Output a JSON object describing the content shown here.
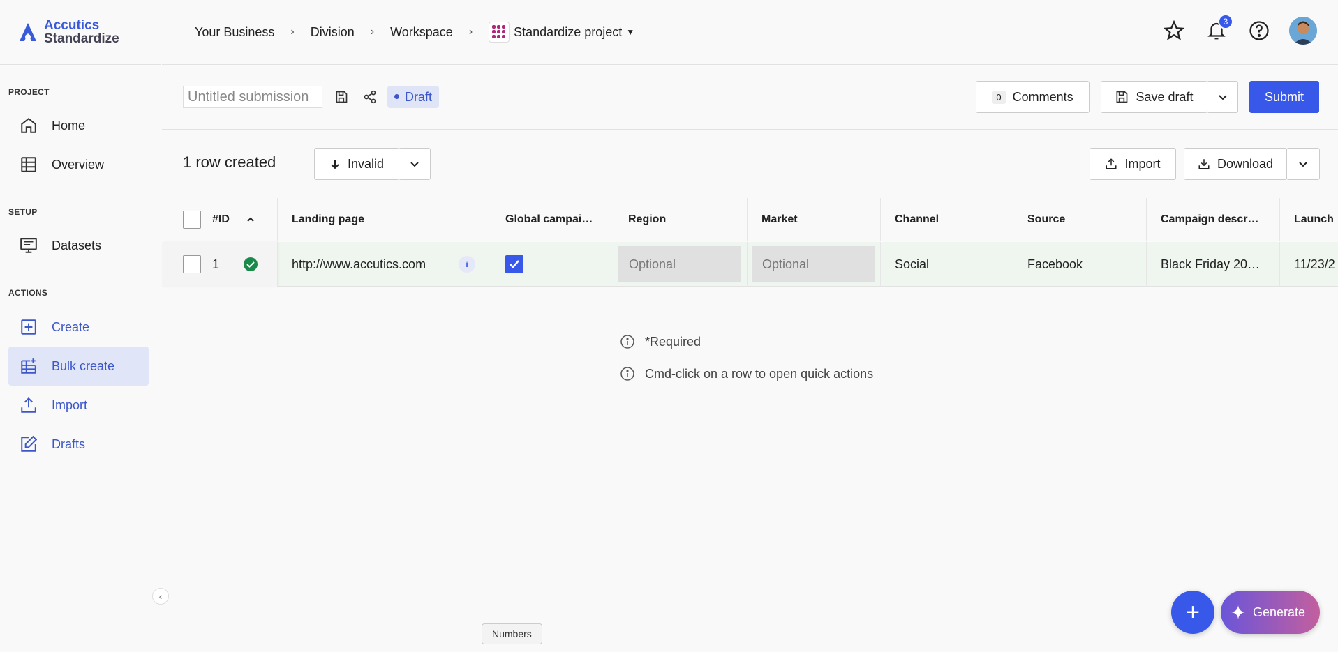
{
  "app": {
    "brand_line1": "Accutics",
    "brand_line2": "Standardize"
  },
  "sidebar": {
    "sections": {
      "project": "PROJECT",
      "setup": "SETUP",
      "actions": "ACTIONS"
    },
    "items": [
      {
        "label": "Home",
        "icon": "home-icon"
      },
      {
        "label": "Overview",
        "icon": "table-icon"
      },
      {
        "label": "Datasets",
        "icon": "datasets-icon"
      },
      {
        "label": "Create",
        "icon": "plus-square-icon"
      },
      {
        "label": "Bulk create",
        "icon": "bulk-create-icon"
      },
      {
        "label": "Import",
        "icon": "upload-icon"
      },
      {
        "label": "Drafts",
        "icon": "edit-icon"
      }
    ]
  },
  "breadcrumb": {
    "business": "Your Business",
    "division": "Division",
    "workspace": "Workspace",
    "project": "Standardize project"
  },
  "header": {
    "notification_count": "3"
  },
  "submission": {
    "title_placeholder": "Untitled submission",
    "status": "Draft",
    "comments_count": "0",
    "comments_label": "Comments",
    "save_draft_label": "Save draft",
    "submit_label": "Submit"
  },
  "toolbar": {
    "rows_created": "1 row created",
    "filter_label": "Invalid",
    "import_label": "Import",
    "download_label": "Download"
  },
  "table": {
    "columns": [
      "#ID",
      "Landing page",
      "Global campai…",
      "Region",
      "Market",
      "Channel",
      "Source",
      "Campaign descr…",
      "Launch"
    ],
    "row": {
      "id": "1",
      "landing_page": "http://www.accutics.com",
      "info": "i",
      "region": "Optional",
      "market": "Optional",
      "channel": "Social",
      "source": "Facebook",
      "campaign_description": "Black Friday 20…",
      "launch": "11/23/2"
    }
  },
  "notes": {
    "required": "*Required",
    "quick_actions": "Cmd-click on a row to open quick actions"
  },
  "fab": {
    "add": "+",
    "generate": "Generate"
  },
  "tooltip": "Numbers",
  "colors": {
    "accent": "#3858e9",
    "valid": "#1a8a4a",
    "row_bg": "#eef6ef"
  }
}
